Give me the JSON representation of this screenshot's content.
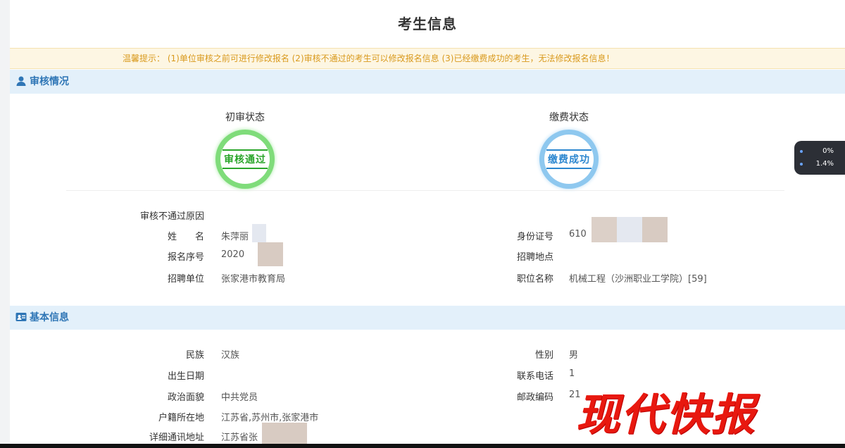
{
  "page": {
    "title": "考生信息",
    "notice": "温馨提示： (1)单位审核之前可进行修改报名 (2)审核不通过的考生可以修改报名信息 (3)已经缴费成功的考生，无法修改报名信息！"
  },
  "review": {
    "section_title": "审核情况",
    "initial_review_label": "初审状态",
    "initial_review_stamp": "审核通过",
    "payment_label": "缴费状态",
    "payment_stamp": "缴费成功",
    "fields": {
      "reject_reason_label": "审核不通过原因",
      "name_label": "姓　　名",
      "name_value": "朱萍丽",
      "reg_no_label": "报名序号",
      "reg_no_value": "2020",
      "unit_label": "招聘单位",
      "unit_value": "张家港市教育局",
      "id_label": "身份证号",
      "id_value": "610",
      "site_label": "招聘地点",
      "site_value": "",
      "position_label": "职位名称",
      "position_value": "机械工程（沙洲职业工学院）[59]"
    }
  },
  "basic": {
    "section_title": "基本信息",
    "fields": {
      "ethnicity_label": "民族",
      "ethnicity_value": "汉族",
      "gender_label": "性别",
      "gender_value": "男",
      "birth_label": "出生日期",
      "birth_value": "",
      "phone_label": "联系电话",
      "phone_value": "1",
      "political_label": "政治面貌",
      "political_value": "中共党员",
      "postcode_label": "邮政编码",
      "postcode_value": "21",
      "hukou_label": "户籍所在地",
      "hukou_value": "江苏省,苏州市,张家港市",
      "address_label": "详细通讯地址",
      "address_value": "江苏省张"
    }
  },
  "widget": {
    "line1": "0%",
    "line2": "1.4%"
  },
  "watermark": "现代快报",
  "colors": {
    "section_bg": "#e3f0fa",
    "section_text": "#2f76b6",
    "notice_text": "#d99a1e",
    "stamp_green": "#2aa52a",
    "stamp_blue": "#2b86cf",
    "watermark": "#e8180f"
  }
}
